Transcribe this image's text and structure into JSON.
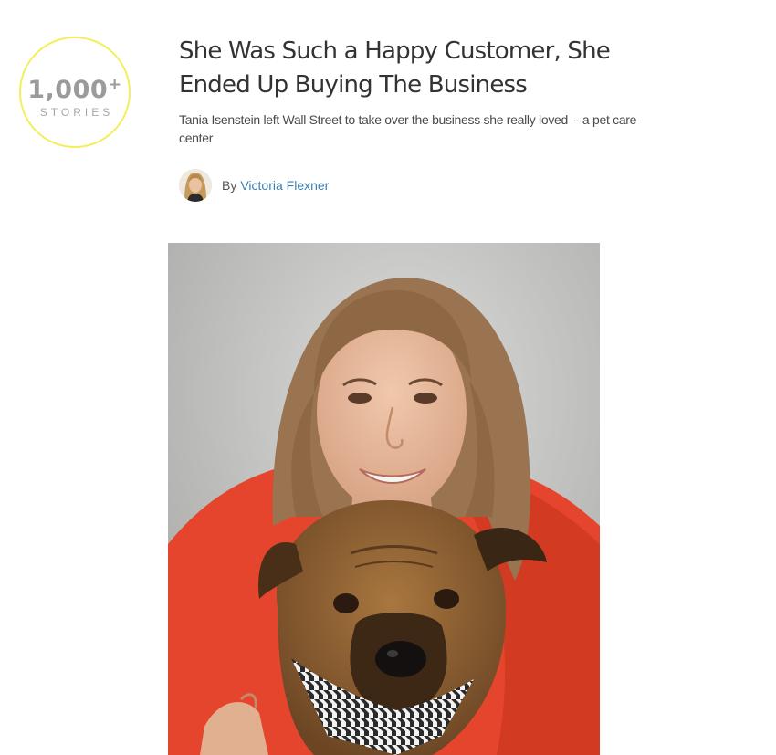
{
  "badge": {
    "number": "1,000",
    "plus": "+",
    "label": "STORIES"
  },
  "article": {
    "title": "She Was Such a Happy Customer, She Ended Up Buying The Business",
    "subtitle": "Tania Isenstein left Wall Street to take over the business she really loved -- a pet care center",
    "byline_prefix": "By",
    "author": "Victoria Flexner"
  },
  "images": {
    "author_avatar": "author-photo",
    "hero": "woman-hugging-dog-photo"
  },
  "colors": {
    "badge_ring": "#f3ef5b",
    "badge_text": "#9b9b9b",
    "author_link": "#3e7fae",
    "title_text": "#333333"
  }
}
